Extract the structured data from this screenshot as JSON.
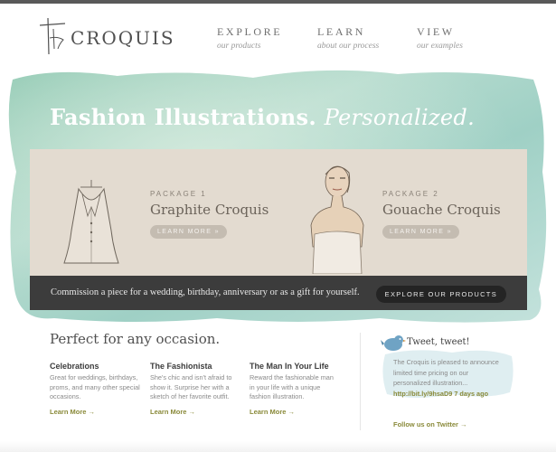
{
  "header": {
    "logo_text": "CROQUIS",
    "nav": [
      {
        "title": "EXPLORE",
        "subtitle": "our products"
      },
      {
        "title": "LEARN",
        "subtitle": "about our process"
      },
      {
        "title": "VIEW",
        "subtitle": "our examples"
      }
    ]
  },
  "hero": {
    "title_bold": "Fashion Illustrations.",
    "title_italic": "Personalized.",
    "packages": [
      {
        "number": "PACKAGE 1",
        "name": "Graphite Croquis",
        "button": "LEARN MORE »"
      },
      {
        "number": "PACKAGE 2",
        "name": "Gouache Croquis",
        "button": "LEARN MORE »"
      }
    ],
    "bar_text": "Commission a piece for a wedding, birthday, anniversary or as a gift for yourself.",
    "bar_button": "EXPLORE OUR PRODUCTS"
  },
  "occasion": {
    "heading": "Perfect for any occasion.",
    "columns": [
      {
        "title": "Celebrations",
        "text": "Great for weddings, birthdays, proms, and many other special occasions.",
        "link": "Learn More →"
      },
      {
        "title": "The Fashionista",
        "text": "She's chic and isn't afraid to show it. Surprise her with a sketch of her favorite outfit.",
        "link": "Learn More →"
      },
      {
        "title": "The Man In Your Life",
        "text": "Reward the fashionable man in your life with a unique fashion illustration.",
        "link": "Learn More →"
      }
    ]
  },
  "twitter": {
    "title": "Tweet, tweet!",
    "body": "The Croquis is pleased to announce limited time pricing on our personalized illustration...",
    "link": "http://bit.ly/9hsaD9",
    "time": "7 days ago",
    "follow": "Follow us on Twitter →"
  },
  "colors": {
    "watercolor": "#a9d2c2",
    "panel": "#e3dbd0",
    "bar": "#3c3c3c",
    "link": "#8a8a3a"
  },
  "icons": [
    "logo-mark-icon",
    "bluebird-icon"
  ]
}
